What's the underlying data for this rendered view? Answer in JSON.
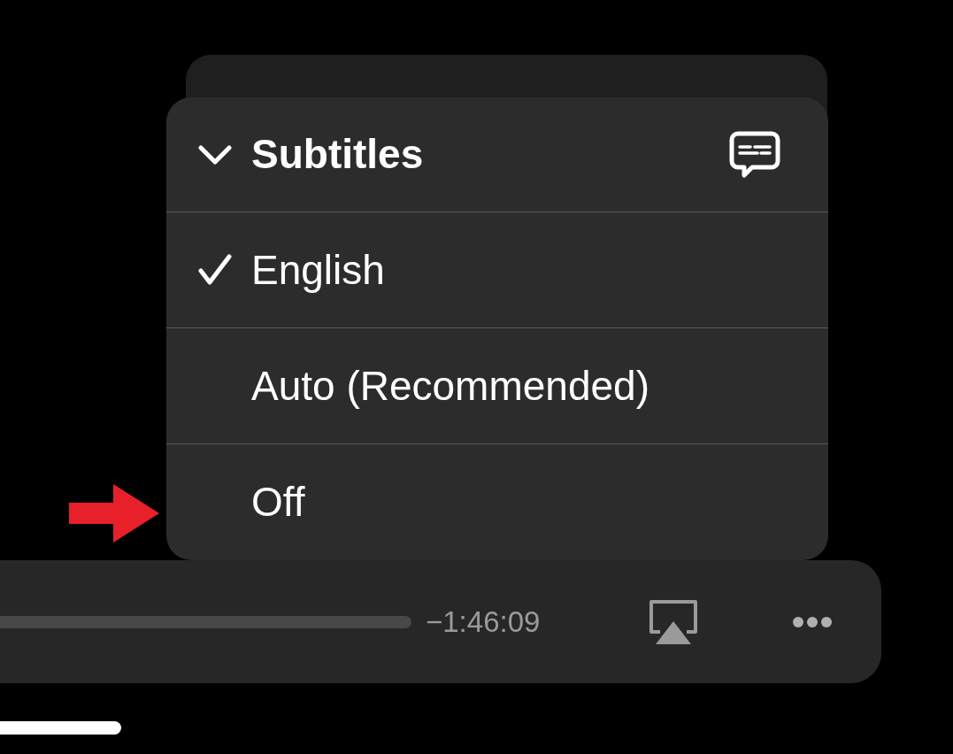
{
  "menu": {
    "title": "Subtitles",
    "expanded": true,
    "items": [
      {
        "label": "English",
        "selected": true
      },
      {
        "label": "Auto (Recommended)",
        "selected": false
      },
      {
        "label": "Off",
        "selected": false
      }
    ]
  },
  "player": {
    "remaining_time": "−1:46:09"
  }
}
